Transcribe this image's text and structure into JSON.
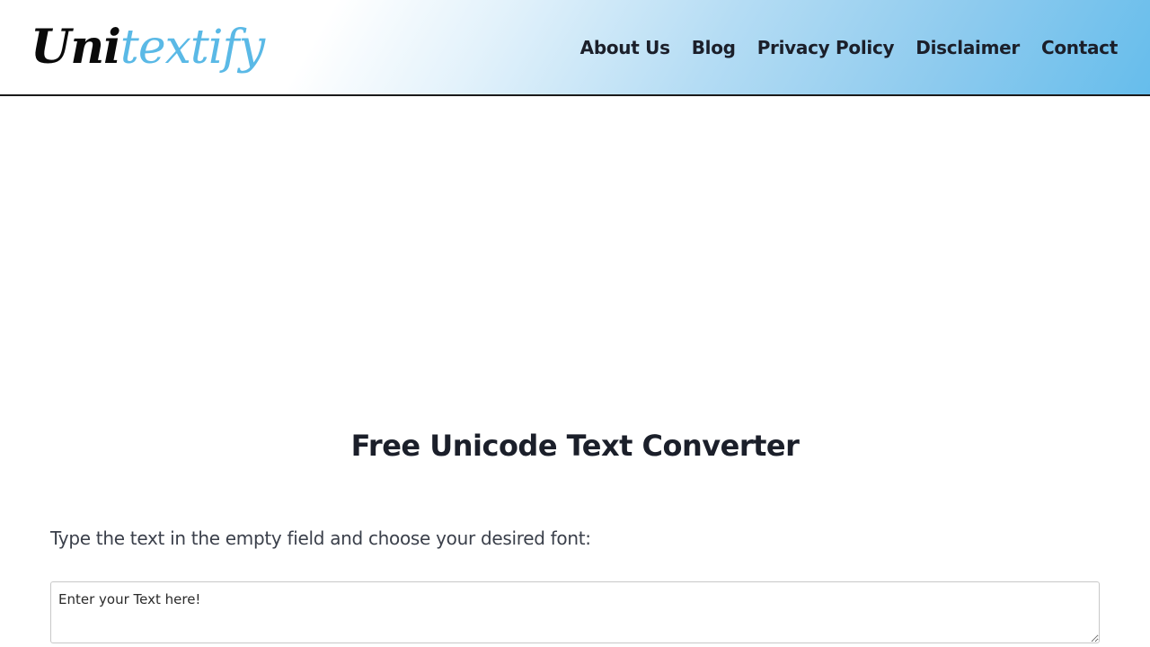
{
  "header": {
    "logo": {
      "part_a": "Uni",
      "part_b": "textify",
      "colors": {
        "part_a": "#0a0a0a",
        "part_b": "#5ab9e6"
      }
    },
    "nav": [
      {
        "label": "About Us"
      },
      {
        "label": "Blog"
      },
      {
        "label": "Privacy Policy"
      },
      {
        "label": "Disclaimer"
      },
      {
        "label": "Contact"
      }
    ],
    "gradient_colors": [
      "#ffffff",
      "#e3f2fb",
      "#8ccaee",
      "#66bdec"
    ]
  },
  "main": {
    "title": "Free Unicode Text Converter",
    "instructions": "Type the text in the empty field and choose your desired font:",
    "input": {
      "placeholder": "Enter your Text here!",
      "value": ""
    }
  }
}
